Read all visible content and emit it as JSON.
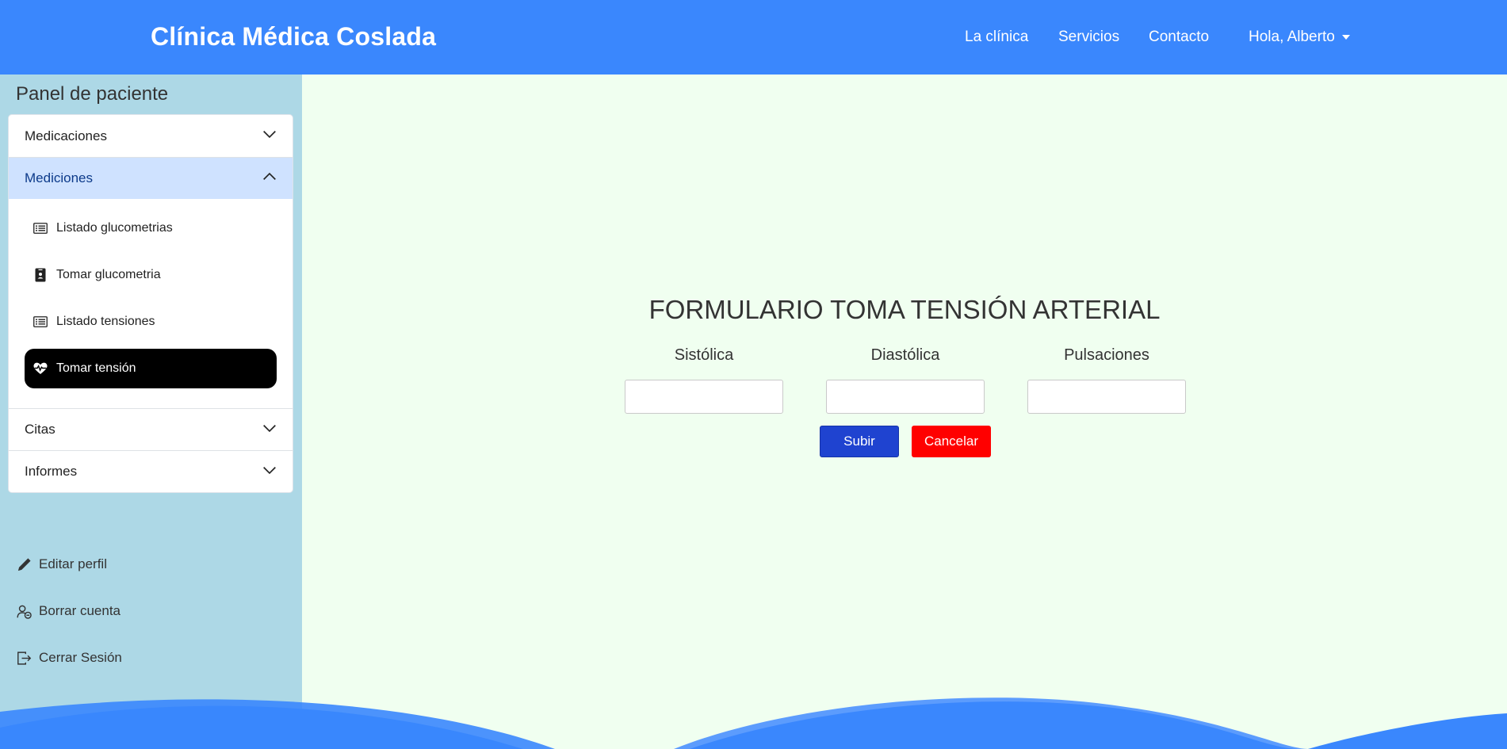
{
  "navbar": {
    "brand": "Clínica Médica Coslada",
    "links": [
      "La clínica",
      "Servicios",
      "Contacto"
    ],
    "user": "Hola, Alberto"
  },
  "sidebar": {
    "title": "Panel de paciente",
    "sections": [
      {
        "label": "Medicaciones",
        "expanded": false
      },
      {
        "label": "Mediciones",
        "expanded": true,
        "items": [
          {
            "label": "Listado glucometrias",
            "icon": "list-icon",
            "active": false
          },
          {
            "label": "Tomar glucometria",
            "icon": "clipboard-person-icon",
            "active": false
          },
          {
            "label": "Listado tensiones",
            "icon": "list-icon",
            "active": false
          },
          {
            "label": "Tomar tensión",
            "icon": "heart-pulse-icon",
            "active": true
          }
        ]
      },
      {
        "label": "Citas",
        "expanded": false
      },
      {
        "label": "Informes",
        "expanded": false
      }
    ],
    "bottom_links": [
      {
        "label": "Editar perfil",
        "icon": "pencil-icon"
      },
      {
        "label": "Borrar cuenta",
        "icon": "person-remove-icon"
      },
      {
        "label": "Cerrar Sesión",
        "icon": "logout-icon"
      }
    ]
  },
  "form": {
    "title": "FORMULARIO TOMA TENSIÓN ARTERIAL",
    "fields": [
      {
        "label": "Sistólica",
        "value": ""
      },
      {
        "label": "Diastólica",
        "value": ""
      },
      {
        "label": "Pulsaciones",
        "value": ""
      }
    ],
    "submit_label": "Subir",
    "cancel_label": "Cancelar"
  },
  "colors": {
    "navbar": "#3a87fd",
    "sidebar": "#add8e6",
    "content_bg": "#f0fff0",
    "submit": "#1f43d0",
    "cancel": "#ff0000",
    "active_item": "#000000"
  }
}
